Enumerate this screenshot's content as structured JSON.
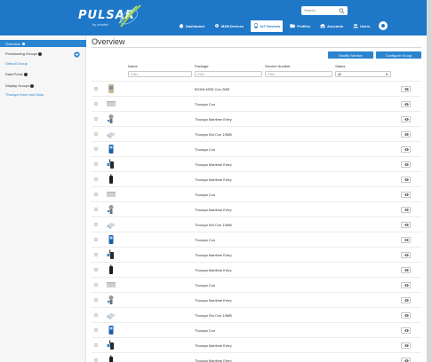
{
  "header": {
    "logo_word": "PULSAR",
    "logo_sub": "by pinatek",
    "search_placeholder": "Search",
    "nav": [
      {
        "label": "Dashboard",
        "icon": "home-icon",
        "active": false
      },
      {
        "label": "M2M Devices",
        "icon": "gear-icon",
        "active": false
      },
      {
        "label": "IoT Devices",
        "icon": "phone-icon",
        "active": true
      },
      {
        "label": "Profiles",
        "icon": "folder-icon",
        "active": false
      },
      {
        "label": "Accounts",
        "icon": "building-icon",
        "active": false
      },
      {
        "label": "Users",
        "icon": "users-icon",
        "active": false
      }
    ]
  },
  "sidebar": {
    "overview": "Overview",
    "provisioning_groups": "Provisioning Groups",
    "default_group": "Default Group",
    "data_pools": "Data Pools",
    "display_groups": "Display Groups",
    "thuraya_voice_data": "Thuraya Voice and Data"
  },
  "main": {
    "title": "Overview",
    "modify_btn": "Modify Service",
    "configure_btn": "Configure Group",
    "columns": {
      "name": "Name",
      "package": "Package",
      "service_number": "Service Number",
      "status": "Status"
    },
    "filters": {
      "name_placeholder": "Filter",
      "package_placeholder": "Filter",
      "service_placeholder": "Filter",
      "status_value": "All"
    },
    "rows": [
      {
        "package": "BGAN M2M Con 2MB",
        "thumb": "satellite-terminal"
      },
      {
        "package": "Thuraya Con",
        "thumb": "silver-box"
      },
      {
        "package": "Thuraya Maritime Entry",
        "thumb": "dome-antenna"
      },
      {
        "package": "Thuraya Std Con 10MB",
        "thumb": "flat-terminal"
      },
      {
        "package": "Thuraya Con",
        "thumb": "blue-phone"
      },
      {
        "package": "Thuraya Maritime Entry",
        "thumb": "sat-phone"
      },
      {
        "package": "Thuraya Maritime Entry",
        "thumb": "black-phone"
      },
      {
        "package": "Thuraya Con",
        "thumb": "silver-box"
      },
      {
        "package": "Thuraya Maritime Entry",
        "thumb": "dome-antenna"
      },
      {
        "package": "Thuraya Std Con 10MB",
        "thumb": "flat-terminal"
      },
      {
        "package": "Thuraya Con",
        "thumb": "blue-phone"
      },
      {
        "package": "Thuraya Maritime Entry",
        "thumb": "sat-phone"
      },
      {
        "package": "Thuraya Maritime Entry",
        "thumb": "black-phone"
      },
      {
        "package": "Thuraya Con",
        "thumb": "silver-box"
      },
      {
        "package": "Thuraya Maritime Entry",
        "thumb": "dome-antenna"
      },
      {
        "package": "Thuraya Std Con 10MB",
        "thumb": "flat-terminal"
      },
      {
        "package": "Thuraya Con",
        "thumb": "blue-phone"
      },
      {
        "package": "Thuraya Maritime Entry",
        "thumb": "sat-phone"
      },
      {
        "package": "Thuraya Maritime Entry",
        "thumb": "black-phone"
      }
    ]
  },
  "colors": {
    "brand": "#1f77c8",
    "accent": "#2b84cf"
  }
}
